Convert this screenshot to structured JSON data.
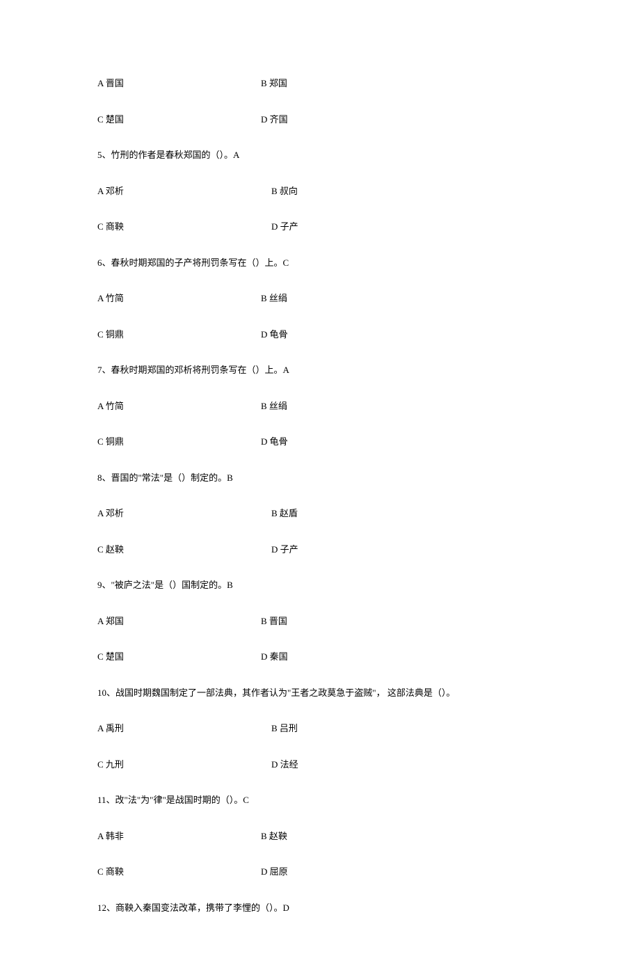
{
  "q4": {
    "a": "A 晋国",
    "b": "B 郑国",
    "c": "C 楚国",
    "d": "D 齐国"
  },
  "q5": {
    "text": "5、竹刑的作者是春秋郑国的（）。A",
    "a": "A 邓析",
    "b": "B 叔向",
    "c": "C 商鞅",
    "d": "D 子产"
  },
  "q6": {
    "text": "6、春秋时期郑国的子产将刑罚条写在（）上。C",
    "a": "A 竹简",
    "b": "B 丝绢",
    "c": "C 铜鼎",
    "d": "D 龟骨"
  },
  "q7": {
    "text": "7、春秋时期郑国的邓析将刑罚条写在（）上。A",
    "a": "A 竹简",
    "b": "B 丝绢",
    "c": "C 铜鼎",
    "d": "D 龟骨"
  },
  "q8": {
    "text": "8、晋国的\"常法\"是（）制定的。B",
    "a": "A 邓析",
    "b": "B 赵盾",
    "c": "C 赵鞅",
    "d": "D 子产"
  },
  "q9": {
    "text": "9、\"被庐之法\"是（）国制定的。B",
    "a": "A 郑国",
    "b": "B 晋国",
    "c": "C 楚国",
    "d": "D 秦国"
  },
  "q10": {
    "text": "10、战国时期魏国制定了一部法典，其作者认为\"王者之政莫急于盗贼\"， 这部法典是（）。",
    "a": "A 禹刑",
    "b": "B 吕刑",
    "c": "C 九刑",
    "d": "D 法经"
  },
  "q11": {
    "text": "11、改\"法\"为\"律\"是战国时期的（）。C",
    "a": "A 韩非",
    "b": "B 赵鞅",
    "c": "C 商鞅",
    "d": "D 屈原"
  },
  "q12": {
    "text": "12、商鞅入秦国变法改革，携带了李悝的（）。D"
  }
}
